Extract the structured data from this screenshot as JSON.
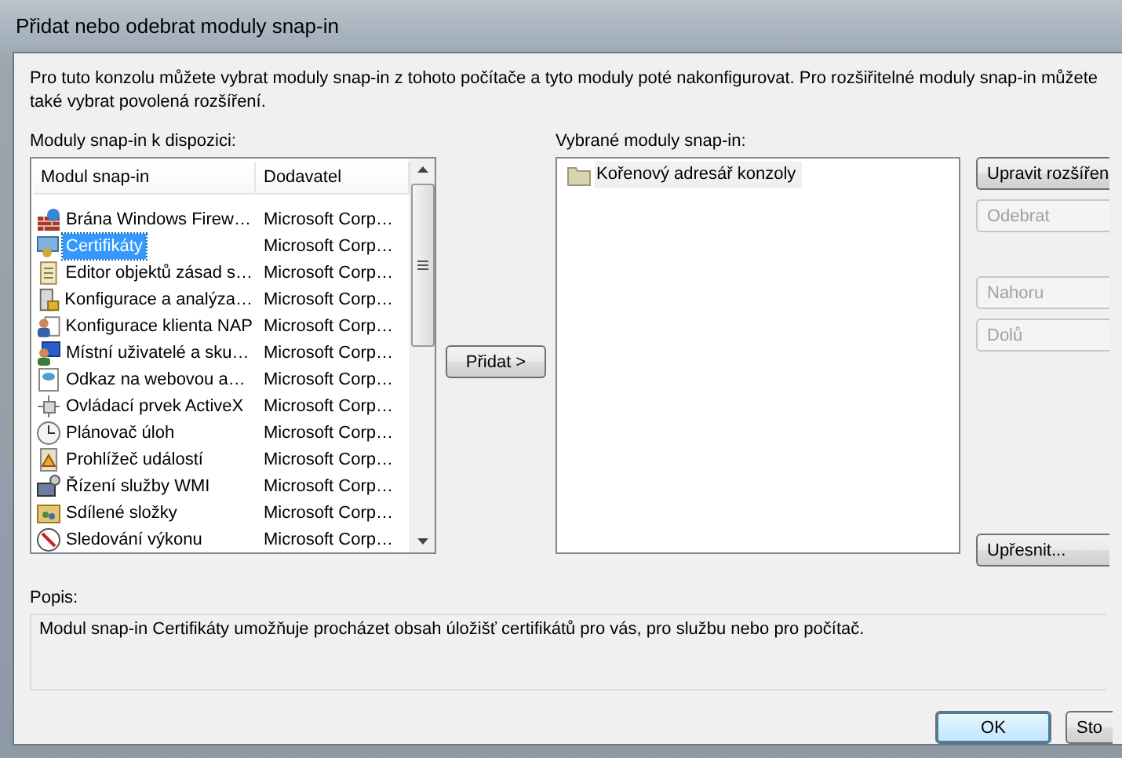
{
  "window": {
    "title": "Přidat nebo odebrat moduly snap-in"
  },
  "intro": "Pro tuto konzolu můžete vybrat moduly snap-in z tohoto počítače a tyto moduly poté nakonfigurovat. Pro rozšiřitelné moduly snap-in můžete také vybrat povolená rozšíření.",
  "available": {
    "label": "Moduly snap-in k dispozici:",
    "columns": [
      "Modul snap-in",
      "Dodavatel"
    ],
    "rows": [
      {
        "name": "Brána Windows Firew…",
        "vendor": "Microsoft Corp…",
        "selected": false
      },
      {
        "name": "Certifikáty",
        "vendor": "Microsoft Corp…",
        "selected": true
      },
      {
        "name": "Editor objektů zásad s…",
        "vendor": "Microsoft Corp…",
        "selected": false
      },
      {
        "name": "Konfigurace a analýza…",
        "vendor": "Microsoft Corp…",
        "selected": false
      },
      {
        "name": "Konfigurace klienta NAP",
        "vendor": "Microsoft Corp…",
        "selected": false
      },
      {
        "name": "Místní uživatelé a sku…",
        "vendor": "Microsoft Corp…",
        "selected": false
      },
      {
        "name": "Odkaz na webovou a…",
        "vendor": "Microsoft Corp…",
        "selected": false
      },
      {
        "name": "Ovládací prvek ActiveX",
        "vendor": "Microsoft Corp…",
        "selected": false
      },
      {
        "name": "Plánovač úloh",
        "vendor": "Microsoft Corp…",
        "selected": false
      },
      {
        "name": "Prohlížeč událostí",
        "vendor": "Microsoft Corp…",
        "selected": false
      },
      {
        "name": "Řízení služby WMI",
        "vendor": "Microsoft Corp…",
        "selected": false
      },
      {
        "name": "Sdílené složky",
        "vendor": "Microsoft Corp…",
        "selected": false
      },
      {
        "name": "Sledování výkonu",
        "vendor": "Microsoft Corp…",
        "selected": false
      }
    ]
  },
  "add_button": "Přidat >",
  "selected_list": {
    "label": "Vybrané moduly snap-in:",
    "items": [
      {
        "label": "Kořenový adresář konzoly",
        "selected": true
      }
    ]
  },
  "side_buttons": [
    {
      "label": "Upravit rozšířen",
      "disabled": false
    },
    {
      "label": "Odebrat",
      "disabled": true
    },
    {
      "label": "Nahoru",
      "disabled": true
    },
    {
      "label": "Dolů",
      "disabled": true
    },
    {
      "label": "Upřesnit...",
      "disabled": false
    }
  ],
  "description": {
    "label": "Popis:",
    "text": "Modul snap-in Certifikáty umožňuje procházet obsah úložišť certifikátů pro vás, pro službu nebo pro počítač."
  },
  "footer_buttons": [
    {
      "label": "OK",
      "default": true
    },
    {
      "label": "Sto",
      "default": false
    }
  ]
}
